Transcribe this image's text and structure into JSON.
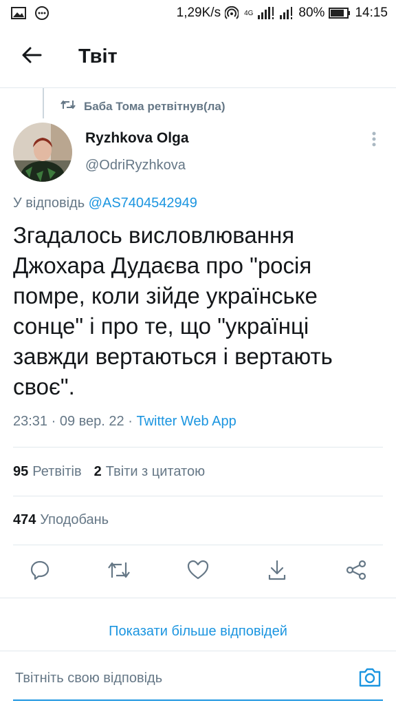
{
  "status_bar": {
    "speed": "1,29K/s",
    "network": "4G",
    "battery": "80%",
    "time": "14:15",
    "icons": [
      "image-notification-icon",
      "chat-notification-icon",
      "hotspot-icon",
      "signal-icon",
      "battery-icon"
    ]
  },
  "header": {
    "title": "Твіт",
    "back_icon": "arrow-left-icon"
  },
  "retweet_context": {
    "text": "Баба Тома ретвітнув(ла)",
    "icon": "retweet-icon"
  },
  "tweet": {
    "author_name": "Ryzhkova Olga",
    "author_handle": "@OdriRyzhkova",
    "reply_prefix": "У відповідь ",
    "reply_to_handle": "@AS7404542949",
    "text": "Згадалось висловлювання Джохара Дудаєва про \"росія помре, коли зійде українське сонце\" і про те, що \"українці завжди вертаються і вертають своє\".",
    "time": "23:31",
    "separator": " · ",
    "date": "09 вер. 22",
    "source": "Twitter Web App"
  },
  "stats": {
    "retweets_count": "95",
    "retweets_label": "Ретвітів",
    "quotes_count": "2",
    "quotes_label": "Твіти з цитатою",
    "likes_count": "474",
    "likes_label": "Уподобань"
  },
  "actions": [
    "reply-icon",
    "retweet-icon",
    "like-icon",
    "download-icon",
    "share-icon"
  ],
  "more_replies": "Показати більше відповідей",
  "compose": {
    "placeholder": "Твітніть свою відповідь",
    "camera_icon": "camera-icon"
  },
  "colors": {
    "accent": "#1b95e0",
    "text": "#14171a",
    "secondary": "#657786",
    "border": "#e1e8ed"
  }
}
